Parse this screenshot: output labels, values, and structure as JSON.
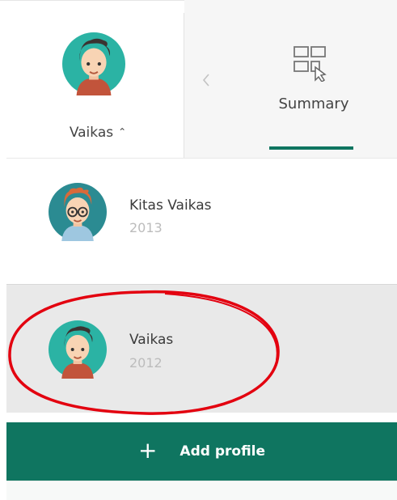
{
  "header": {
    "current_profile": {
      "name": "Vaikas",
      "avatar_icon": "boy-avatar-icon",
      "dropdown_icon": "chevron-up-icon"
    },
    "nav_prev_icon": "chevron-left-icon",
    "summary_tab": {
      "label": "Summary",
      "icon": "dashboard-cursor-icon",
      "active": true
    }
  },
  "profiles": [
    {
      "name": "Kitas Vaikas",
      "year": "2013",
      "avatar_icon": "boy-glasses-avatar-icon",
      "selected": false
    },
    {
      "name": "Vaikas",
      "year": "2012",
      "avatar_icon": "boy-avatar-icon",
      "selected": true
    }
  ],
  "add_profile": {
    "label": "Add profile",
    "icon": "plus-icon"
  },
  "colors": {
    "accent": "#0f7560",
    "avatar_bg": "#2bb3a4",
    "highlight_annotation": "#e3000f",
    "selected_row_bg": "#e9e9e9"
  }
}
